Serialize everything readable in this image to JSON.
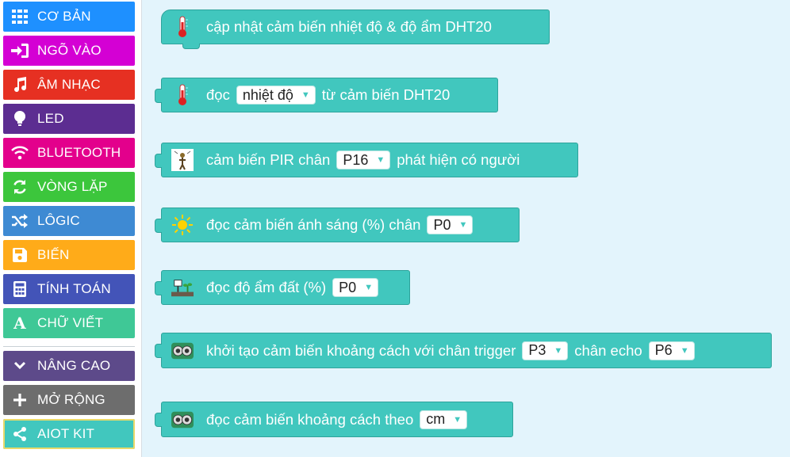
{
  "toolbox": {
    "categories": [
      {
        "label": "CƠ BẢN",
        "color": "#1e90ff",
        "icon": "grid-icon"
      },
      {
        "label": "NGÕ VÀO",
        "color": "#d400d4",
        "icon": "sign-in-icon"
      },
      {
        "label": "ÂM NHẠC",
        "color": "#e63022",
        "icon": "music-note-icon"
      },
      {
        "label": "LED",
        "color": "#5c2d91",
        "icon": "lightbulb-icon"
      },
      {
        "label": "BLUETOOTH",
        "color": "#e3008c",
        "icon": "wifi-icon"
      },
      {
        "label": "VÒNG LẶP",
        "color": "#3cc63c",
        "icon": "refresh-icon"
      },
      {
        "label": "LÔGIC",
        "color": "#3e8ad3",
        "icon": "shuffle-icon"
      },
      {
        "label": "BIẾN",
        "color": "#ffab19",
        "icon": "save-icon"
      },
      {
        "label": "TÍNH TOÁN",
        "color": "#4354b8",
        "icon": "calculator-icon"
      },
      {
        "label": "CHỮ VIẾT",
        "color": "#3fc896",
        "icon": "font-icon"
      },
      {
        "label": "NÂNG CAO",
        "color": "#5d4a8a",
        "icon": "chevron-down-icon"
      },
      {
        "label": "MỞ RỘNG",
        "color": "#6d6d6d",
        "icon": "plus-icon"
      },
      {
        "label": "AIOT KIT",
        "color": "#41c7be",
        "icon": "share-icon"
      }
    ]
  },
  "blocks": {
    "b1": {
      "text": "cập nhật cảm biến nhiệt độ & độ ẩm DHT20",
      "icon": "thermometer-icon"
    },
    "b2": {
      "pre": "đọc",
      "dropdown": "nhiệt độ",
      "post": "từ cảm biến DHT20",
      "icon": "thermometer-icon"
    },
    "b3": {
      "pre": "cảm biến PIR chân",
      "dropdown": "P16",
      "post": "phát hiện có người",
      "icon": "pir-person-icon"
    },
    "b4": {
      "pre": "đọc cảm biến ánh sáng (%) chân",
      "dropdown": "P0",
      "icon": "sun-icon"
    },
    "b5": {
      "pre": "đọc độ ẩm đất (%)",
      "dropdown": "P0",
      "icon": "soil-sensor-icon"
    },
    "b6": {
      "pre": "khởi tạo cảm biến khoảng cách với chân trigger",
      "dropdown": "P3",
      "mid": "chân echo",
      "dropdown2": "P6",
      "icon": "ultrasonic-sensor-icon"
    },
    "b7": {
      "pre": "đọc cảm biến khoảng cách theo",
      "dropdown": "cm",
      "icon": "ultrasonic-sensor-icon"
    }
  },
  "colors": {
    "block": "#41c7be",
    "workspace": "#e3f4fc"
  }
}
